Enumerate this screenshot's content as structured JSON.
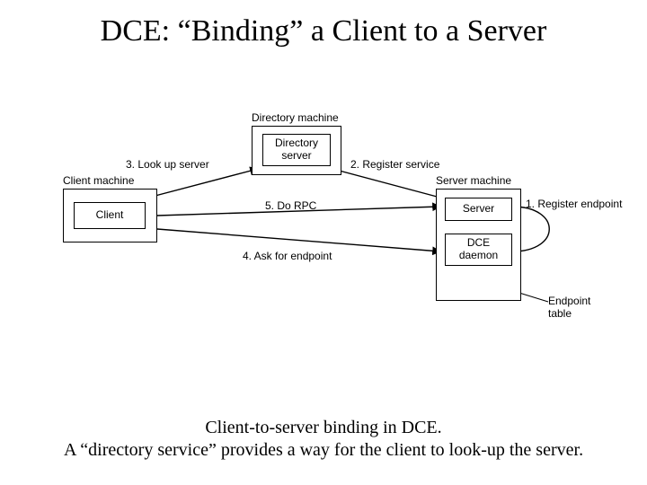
{
  "title": "DCE: “Binding” a Client to a Server",
  "caption_line1": "Client-to-server binding in DCE.",
  "caption_line2": "A “directory service” provides a way for the client to look-up the server.",
  "labels": {
    "directory_machine": "Directory machine",
    "client_machine": "Client machine",
    "server_machine": "Server machine",
    "endpoint_table": "Endpoint\ntable"
  },
  "boxes": {
    "client": "Client",
    "directory_server": "Directory\nserver",
    "server": "Server",
    "dce_daemon": "DCE\ndaemon"
  },
  "steps": {
    "s1": "1. Register endpoint",
    "s2": "2. Register service",
    "s3": "3. Look up server",
    "s4": "4. Ask for endpoint",
    "s5": "5. Do RPC"
  },
  "chart_data": {
    "type": "diagram",
    "title": "DCE client-to-server binding",
    "nodes": [
      {
        "id": "client",
        "label": "Client",
        "group": "Client machine"
      },
      {
        "id": "directory_server",
        "label": "Directory server",
        "group": "Directory machine"
      },
      {
        "id": "server",
        "label": "Server",
        "group": "Server machine"
      },
      {
        "id": "dce_daemon",
        "label": "DCE daemon",
        "group": "Server machine"
      },
      {
        "id": "endpoint_table",
        "label": "Endpoint table",
        "group": "Server machine"
      }
    ],
    "edges": [
      {
        "step": 1,
        "from": "server",
        "to": "dce_daemon",
        "label": "Register endpoint"
      },
      {
        "step": 2,
        "from": "server",
        "to": "directory_server",
        "label": "Register service"
      },
      {
        "step": 3,
        "from": "client",
        "to": "directory_server",
        "label": "Look up server"
      },
      {
        "step": 4,
        "from": "client",
        "to": "dce_daemon",
        "label": "Ask for endpoint"
      },
      {
        "step": 5,
        "from": "client",
        "to": "server",
        "label": "Do RPC"
      }
    ]
  }
}
